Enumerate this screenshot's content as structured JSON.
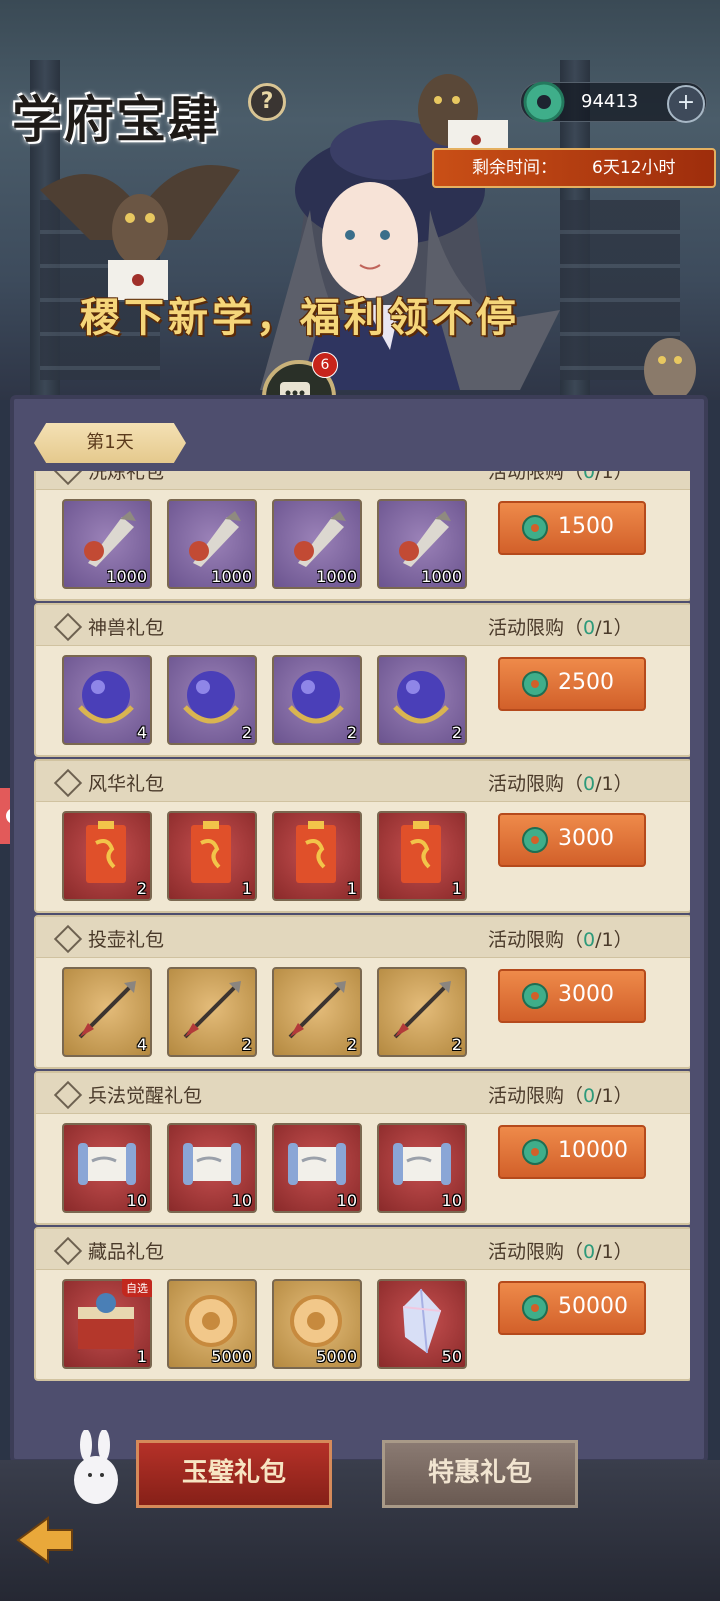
{
  "header": {
    "title": "学府宝肆",
    "currency_value": "94413",
    "time_label": "剩余时间：",
    "time_value": "6天12小时",
    "slogan": "稷下新学，福利领不停",
    "chat_badge": "6"
  },
  "day_tab": "第1天",
  "packs": [
    {
      "name": "洗炼礼包",
      "limit_prefix": "活动限购（",
      "limit_count": "0",
      "limit_suffix": "/1）",
      "items": [
        {
          "qty": "1000",
          "color": "purple",
          "icon": "spearhead-icon"
        },
        {
          "qty": "1000",
          "color": "purple",
          "icon": "spearhead-icon"
        },
        {
          "qty": "1000",
          "color": "purple",
          "icon": "spearhead-icon"
        },
        {
          "qty": "1000",
          "color": "purple",
          "icon": "spearhead-icon"
        }
      ],
      "price": "1500"
    },
    {
      "name": "神兽礼包",
      "limit_prefix": "活动限购（",
      "limit_count": "0",
      "limit_suffix": "/1）",
      "items": [
        {
          "qty": "4",
          "color": "purple",
          "icon": "orb-icon"
        },
        {
          "qty": "2",
          "color": "purple",
          "icon": "orb-icon"
        },
        {
          "qty": "2",
          "color": "purple",
          "icon": "orb-icon"
        },
        {
          "qty": "2",
          "color": "purple",
          "icon": "orb-icon"
        }
      ],
      "price": "2500"
    },
    {
      "name": "风华礼包",
      "limit_prefix": "活动限购（",
      "limit_count": "0",
      "limit_suffix": "/1）",
      "items": [
        {
          "qty": "2",
          "color": "red",
          "icon": "red-envelope-icon"
        },
        {
          "qty": "1",
          "color": "red",
          "icon": "red-envelope-icon"
        },
        {
          "qty": "1",
          "color": "red",
          "icon": "red-envelope-icon"
        },
        {
          "qty": "1",
          "color": "red",
          "icon": "red-envelope-icon"
        }
      ],
      "price": "3000"
    },
    {
      "name": "投壶礼包",
      "limit_prefix": "活动限购（",
      "limit_count": "0",
      "limit_suffix": "/1）",
      "items": [
        {
          "qty": "4",
          "color": "gold",
          "icon": "arrow-icon"
        },
        {
          "qty": "2",
          "color": "gold",
          "icon": "arrow-icon"
        },
        {
          "qty": "2",
          "color": "gold",
          "icon": "arrow-icon"
        },
        {
          "qty": "2",
          "color": "gold",
          "icon": "arrow-icon"
        }
      ],
      "price": "3000"
    },
    {
      "name": "兵法觉醒礼包",
      "limit_prefix": "活动限购（",
      "limit_count": "0",
      "limit_suffix": "/1）",
      "items": [
        {
          "qty": "10",
          "color": "red",
          "icon": "scroll-icon"
        },
        {
          "qty": "10",
          "color": "red",
          "icon": "scroll-icon"
        },
        {
          "qty": "10",
          "color": "red",
          "icon": "scroll-icon"
        },
        {
          "qty": "10",
          "color": "red",
          "icon": "scroll-icon"
        }
      ],
      "price": "10000"
    },
    {
      "name": "藏品礼包",
      "limit_prefix": "活动限购（",
      "limit_count": "0",
      "limit_suffix": "/1）",
      "items": [
        {
          "qty": "1",
          "color": "red",
          "icon": "treasure-chest-icon",
          "tag": "自选"
        },
        {
          "qty": "5000",
          "color": "gold",
          "icon": "jade-ring-icon"
        },
        {
          "qty": "5000",
          "color": "gold",
          "icon": "jade-ring-icon"
        },
        {
          "qty": "50",
          "color": "red",
          "icon": "crystal-icon"
        }
      ],
      "price": "50000"
    }
  ],
  "bottom_tabs": {
    "tab1": "玉璧礼包",
    "tab2": "特惠礼包"
  },
  "colors": {
    "accent": "#d2602a",
    "jade": "#3fae8a",
    "panel": "#4e4e6e"
  }
}
